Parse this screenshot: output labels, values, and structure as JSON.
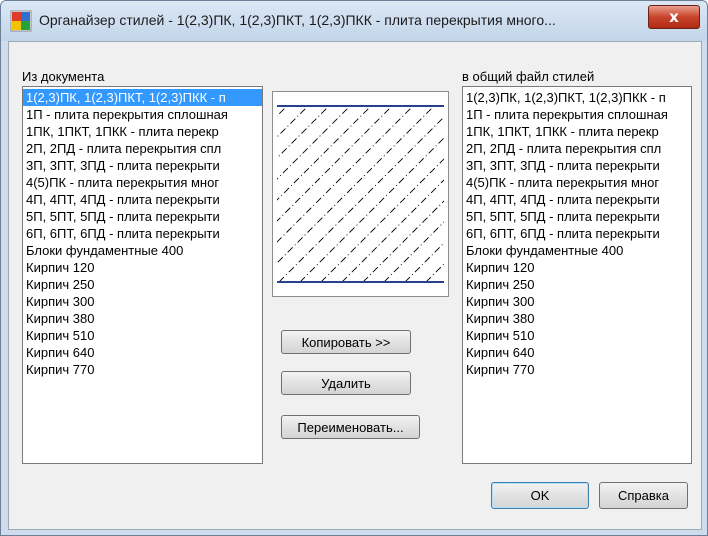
{
  "window": {
    "title": "Органайзер стилей - 1(2,3)ПК, 1(2,3)ПКТ, 1(2,3)ПКК - плита перекрытия много...",
    "close_glyph": "x"
  },
  "left_list": {
    "label": "Из документа",
    "selected_index": 0,
    "items": [
      "1(2,3)ПК, 1(2,3)ПКТ, 1(2,3)ПКК - п",
      "1П - плита перекрытия сплошная",
      "1ПК, 1ПКТ, 1ПКК - плита перекр",
      "2П, 2ПД - плита перекрытия спл",
      "3П, 3ПТ, 3ПД - плита перекрыти",
      "4(5)ПК  - плита перекрытия мног",
      "4П, 4ПТ, 4ПД - плита перекрыти",
      "5П, 5ПТ, 5ПД - плита перекрыти",
      "6П, 6ПТ, 6ПД - плита перекрыти",
      "Блоки фундаментные 400",
      "Кирпич 120",
      "Кирпич 250",
      "Кирпич 300",
      "Кирпич 380",
      "Кирпич 510",
      "Кирпич 640",
      "Кирпич 770"
    ]
  },
  "right_list": {
    "label": "в общий файл стилей",
    "items": [
      "1(2,3)ПК, 1(2,3)ПКТ, 1(2,3)ПКК - п",
      "1П - плита перекрытия сплошная",
      "1ПК, 1ПКТ, 1ПКК - плита перекр",
      "2П, 2ПД - плита перекрытия спл",
      "3П, 3ПТ, 3ПД - плита перекрыти",
      "4(5)ПК  - плита перекрытия мног",
      "4П, 4ПТ, 4ПД - плита перекрыти",
      "5П, 5ПТ, 5ПД - плита перекрыти",
      "6П, 6ПТ, 6ПД - плита перекрыти",
      "Блоки фундаментные 400",
      "Кирпич 120",
      "Кирпич 250",
      "Кирпич 300",
      "Кирпич 380",
      "Кирпич 510",
      "Кирпич 640",
      "Кирпич 770"
    ]
  },
  "buttons": {
    "copy": "Копировать >>",
    "delete": "Удалить",
    "rename": "Переименовать...",
    "ok": "OK",
    "help": "Справка"
  },
  "colors": {
    "selection": "#3399ff",
    "preview_line": "#2b3f8f",
    "hatch": "#000000"
  }
}
